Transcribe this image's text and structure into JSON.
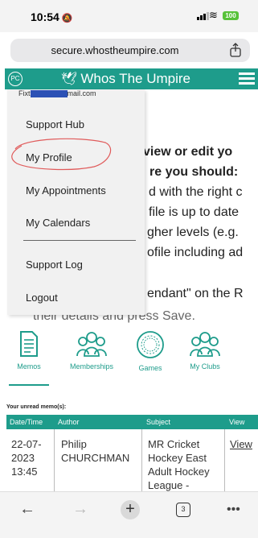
{
  "status_bar": {
    "time": "10:54",
    "battery": "100"
  },
  "browser": {
    "url": "secure.whostheumpire.com",
    "tab_count": "3"
  },
  "site": {
    "avatar": "PC",
    "title": "Whos The Umpire"
  },
  "menu": {
    "email_prefix": "Fixt",
    "email_suffix": "mail.com",
    "items": [
      "Support Hub",
      "My Profile",
      "My Appointments",
      "My Calendars",
      "Support Log",
      "Logout"
    ]
  },
  "background_text": [
    " view or edit yo",
    "re you should:",
    "d with the right c",
    "file is up to date",
    "gher levels (e.g.",
    "ofile including ad",
    "endant\" on the R",
    "their details and press Save."
  ],
  "icon_tabs": [
    {
      "label": "Memos",
      "icon": "memo-icon",
      "active": true
    },
    {
      "label": "Memberships",
      "icon": "people-group-icon",
      "active": false
    },
    {
      "label": "Games",
      "icon": "ball-icon",
      "active": false
    },
    {
      "label": "My Clubs",
      "icon": "people-group-icon",
      "active": false
    }
  ],
  "memos": {
    "title": "Your unread memo(s):",
    "columns": [
      "Date/Time",
      "Author",
      "Subject",
      "View"
    ],
    "rows": [
      {
        "date": [
          "22-07-",
          "2023",
          "13:45"
        ],
        "author": [
          "Philip",
          "CHURCHMAN"
        ],
        "subject": [
          "MR Cricket",
          "Hockey East",
          "Adult Hockey",
          "League -"
        ],
        "view": "View"
      }
    ]
  },
  "colors": {
    "accent": "#1e9c8b",
    "menu_bg": "#f1f1f1",
    "annotation": "#e05a5a"
  }
}
